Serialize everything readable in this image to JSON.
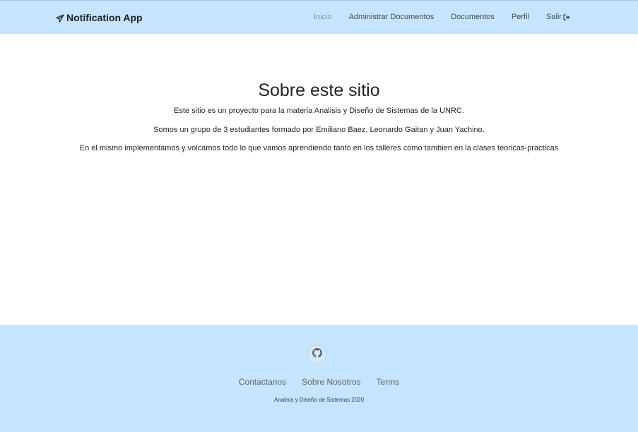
{
  "navbar": {
    "brand": "Notification App",
    "brand_icon": "paper-plane-icon",
    "items": [
      {
        "label": "Inicio",
        "active": true
      },
      {
        "label": "Administrar Documentos",
        "active": false
      },
      {
        "label": "Documentos",
        "active": false
      },
      {
        "label": "Perfil",
        "active": false
      },
      {
        "label": "Salir",
        "active": false,
        "icon": "sign-out-icon"
      }
    ],
    "background": "#c6e4fb"
  },
  "main": {
    "title": "Sobre este sitio",
    "paragraphs": [
      "Este sitio es un proyecto para la materia Analisis y Diseño de Sistemas de la UNRC.",
      "Somos un grupo de 3 estudiantes formado por Emiliano Baez, Leonardo Gaitan y Juan Yachino.",
      "En el mismo implementamos y volcamos todo lo que vamos aprendiendo tanto en los talleres como tambien en la clases teoricas-practicas"
    ]
  },
  "footer": {
    "github_icon": "github-icon",
    "links": [
      "Contactanos",
      "Sobre Nosotros",
      "Terms"
    ],
    "copyright": "Analisis y Diseño de Sistemas 2020",
    "background": "#c6e4fb"
  }
}
